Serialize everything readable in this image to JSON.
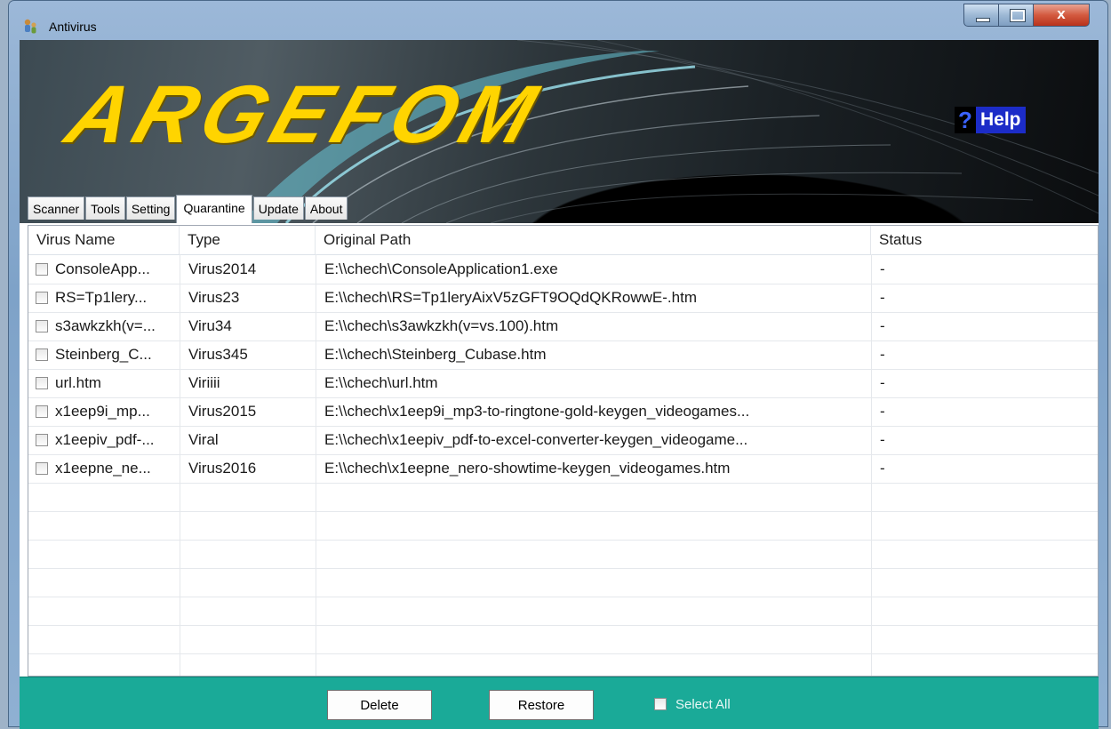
{
  "window": {
    "title": "Antivirus",
    "close_glyph": "x"
  },
  "banner": {
    "logo_text": "ARGEFOM",
    "help_icon": "?",
    "help_label": "Help"
  },
  "tabs": [
    {
      "label": "Scanner"
    },
    {
      "label": "Tools"
    },
    {
      "label": "Setting"
    },
    {
      "label": "Quarantine",
      "active": true
    },
    {
      "label": "Update"
    },
    {
      "label": "About"
    }
  ],
  "table": {
    "columns": [
      "Virus Name",
      "Type",
      "Original Path",
      "Status"
    ],
    "rows": [
      {
        "name": "ConsoleApp...",
        "type": "Virus2014",
        "path": "E:\\\\chech\\ConsoleApplication1.exe",
        "status": "-"
      },
      {
        "name": "RS=Tp1lery...",
        "type": "Virus23",
        "path": "E:\\\\chech\\RS=Tp1leryAixV5zGFT9OQdQKRowwE-.htm",
        "status": "-"
      },
      {
        "name": "s3awkzkh(v=...",
        "type": "Viru34",
        "path": "E:\\\\chech\\s3awkzkh(v=vs.100).htm",
        "status": "-"
      },
      {
        "name": "Steinberg_C...",
        "type": "Virus345",
        "path": "E:\\\\chech\\Steinberg_Cubase.htm",
        "status": "-"
      },
      {
        "name": "url.htm",
        "type": "Viriiii",
        "path": "E:\\\\chech\\url.htm",
        "status": "-"
      },
      {
        "name": "x1eep9i_mp...",
        "type": "Virus2015",
        "path": "E:\\\\chech\\x1eep9i_mp3-to-ringtone-gold-keygen_videogames...",
        "status": "-"
      },
      {
        "name": "x1eepiv_pdf-...",
        "type": "Viral",
        "path": "E:\\\\chech\\x1eepiv_pdf-to-excel-converter-keygen_videogame...",
        "status": "-"
      },
      {
        "name": "x1eepne_ne...",
        "type": "Virus2016",
        "path": "E:\\\\chech\\x1eepne_nero-showtime-keygen_videogames.htm",
        "status": "-"
      }
    ]
  },
  "footer": {
    "delete_label": "Delete",
    "restore_label": "Restore",
    "select_all_label": "Select All"
  },
  "colors": {
    "footer": "#1aaa98",
    "logo": "#ffd400",
    "help": "#1c2cc8"
  }
}
